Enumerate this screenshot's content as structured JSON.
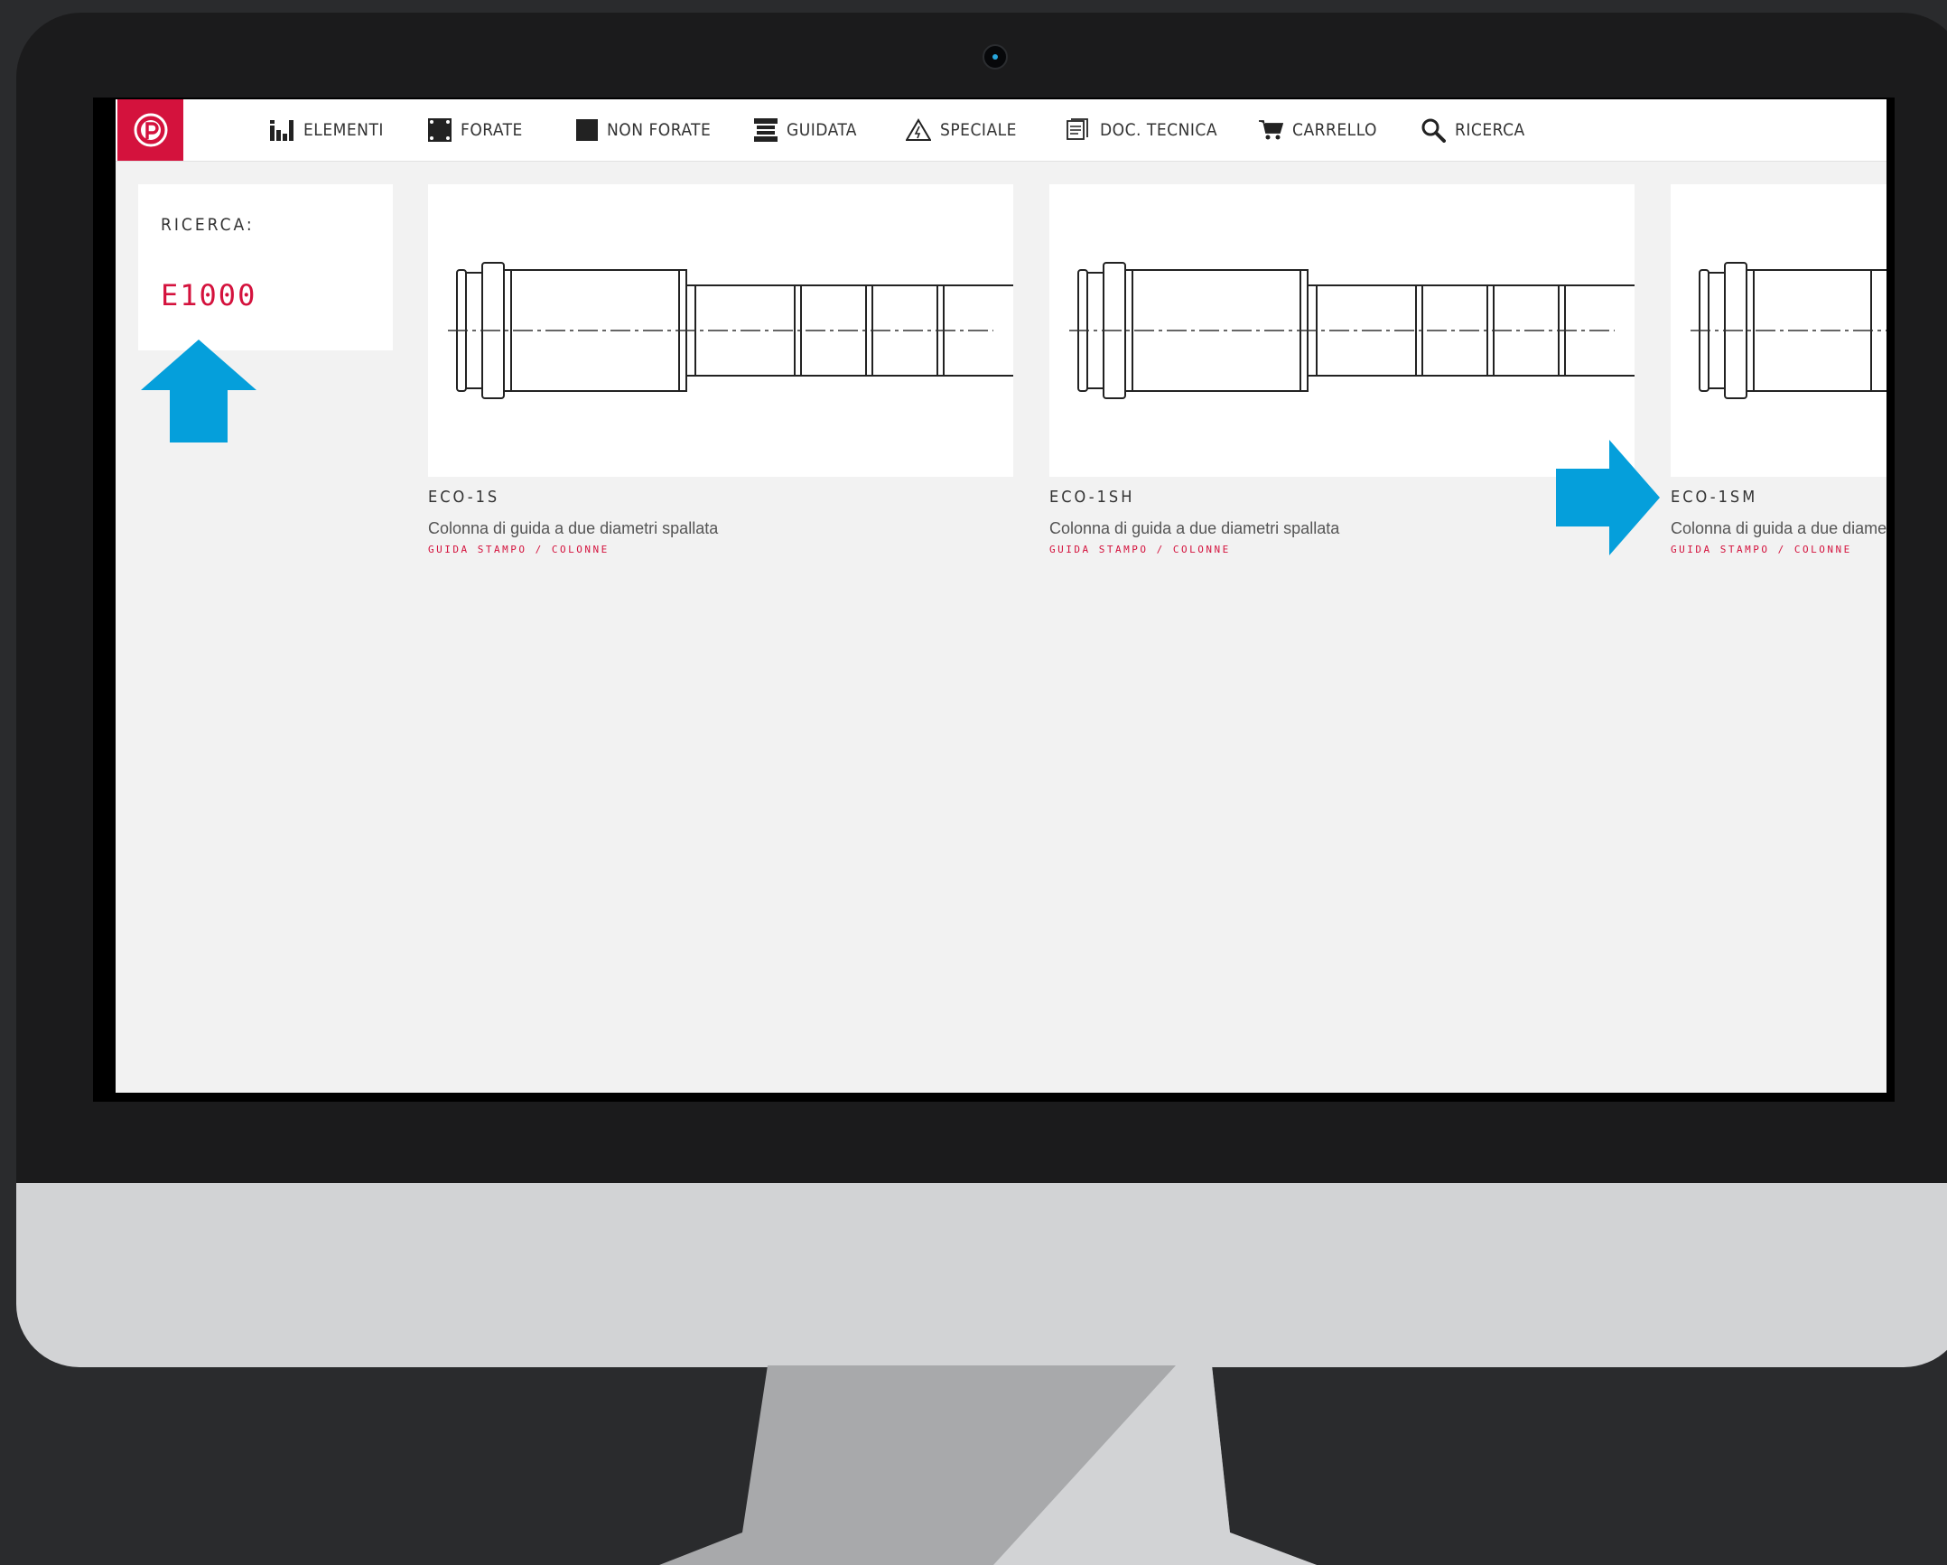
{
  "nav": {
    "items": [
      {
        "label": "ELEMENTI",
        "icon": "bar-chart-icon"
      },
      {
        "label": "FORATE",
        "icon": "drilled-plate-icon"
      },
      {
        "label": "NON FORATE",
        "icon": "solid-plate-icon"
      },
      {
        "label": "GUIDATA",
        "icon": "guided-die-icon"
      },
      {
        "label": "SPECIALE",
        "icon": "warning-triangle-icon"
      },
      {
        "label": "DOC. TECNICA",
        "icon": "document-icon"
      },
      {
        "label": "CARRELLO",
        "icon": "cart-icon"
      },
      {
        "label": "RICERCA",
        "icon": "search-icon"
      }
    ]
  },
  "search": {
    "label": "RICERCA:",
    "value": "E1000"
  },
  "products": [
    {
      "code": "ECO-1S",
      "description": "Colonna di guida a due diametri spallata",
      "category": "GUIDA STAMPO / COLONNE"
    },
    {
      "code": "ECO-1SH",
      "description": "Colonna di guida a due diametri spallata",
      "category": "GUIDA STAMPO / COLONNE"
    },
    {
      "code": "ECO-1SM",
      "description": "Colonna di guida a due diametri spallata",
      "category": "GUIDA STAMPO / COLONNE"
    }
  ],
  "colors": {
    "accent": "#d4123d",
    "annotation": "#059fdb",
    "bezel": "#1b1b1c",
    "chin": "#d2d3d5"
  }
}
